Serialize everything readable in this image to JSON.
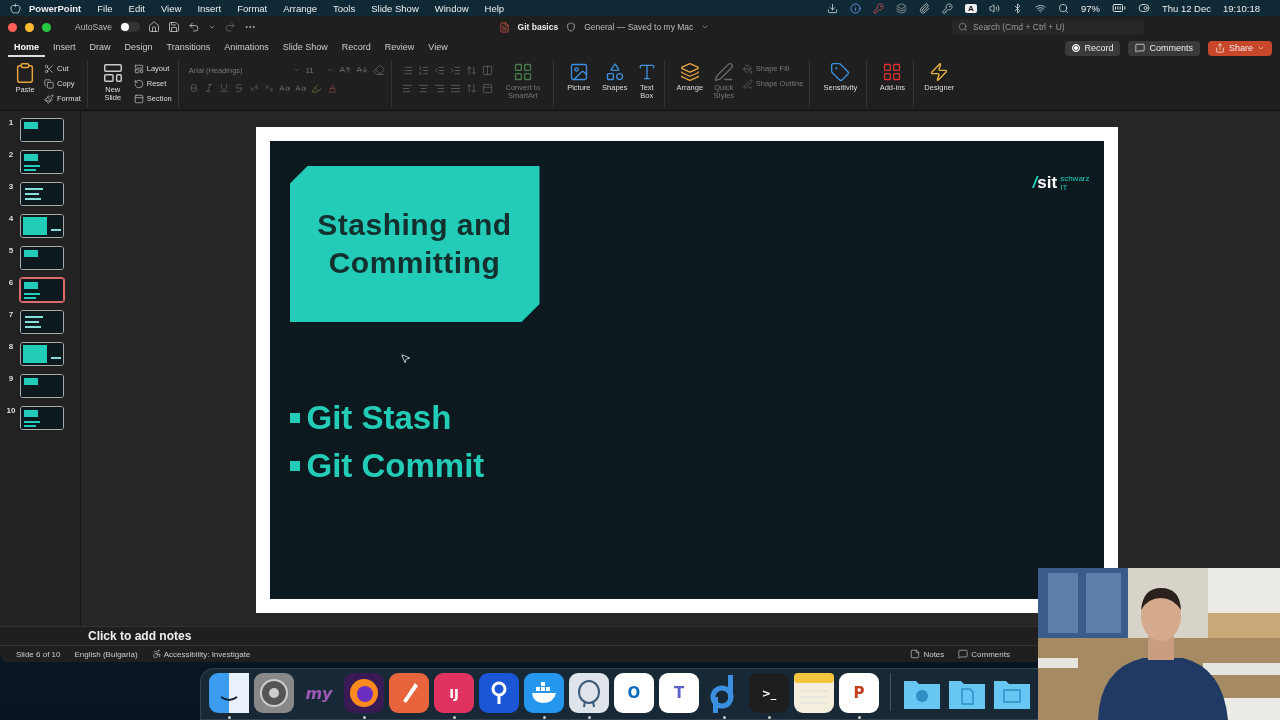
{
  "menu_bar": {
    "app": "PowerPoint",
    "items": [
      "File",
      "Edit",
      "View",
      "Insert",
      "Format",
      "Arrange",
      "Tools",
      "Slide Show",
      "Window",
      "Help"
    ],
    "input_source": "A",
    "battery": "97%",
    "date": "Thu 12 Dec",
    "time": "19:10:18"
  },
  "title_bar": {
    "autosave": {
      "label": "AutoSave",
      "on": false
    },
    "document": "Git basics",
    "status": "General — Saved to my Mac",
    "search": {
      "placeholder": "Search (Cmd + Ctrl + U)"
    }
  },
  "tabs": [
    {
      "label": "Home",
      "selected": true
    },
    {
      "label": "Insert",
      "selected": false
    },
    {
      "label": "Draw",
      "selected": false
    },
    {
      "label": "Design",
      "selected": false
    },
    {
      "label": "Transitions",
      "selected": false
    },
    {
      "label": "Animations",
      "selected": false
    },
    {
      "label": "Slide Show",
      "selected": false
    },
    {
      "label": "Record",
      "selected": false
    },
    {
      "label": "Review",
      "selected": false
    },
    {
      "label": "View",
      "selected": false
    }
  ],
  "actions": [
    {
      "label": "Record",
      "kind": "record"
    },
    {
      "label": "Comments",
      "kind": "comments"
    },
    {
      "label": "Share",
      "kind": "share"
    }
  ],
  "ribbon": {
    "paste": {
      "label": "Paste",
      "disabled": false
    },
    "clipboard": [
      {
        "label": "Cut",
        "disabled": false
      },
      {
        "label": "Copy",
        "disabled": false
      },
      {
        "label": "Format",
        "disabled": false
      }
    ],
    "new_slide": {
      "label": "New Slide",
      "disabled": false
    },
    "slide_tools": [
      {
        "label": "Layout",
        "disabled": false
      },
      {
        "label": "Reset",
        "disabled": false
      },
      {
        "label": "Section",
        "disabled": false
      }
    ],
    "font": {
      "name": "Arial (Headings)",
      "size": "11",
      "disabled": true
    },
    "paragraph": {
      "disabled": true
    },
    "smartart": {
      "label": "Convert to SmartArt",
      "disabled": true
    },
    "insert": [
      {
        "label": "Picture",
        "disabled": false
      },
      {
        "label": "Shapes",
        "disabled": false
      },
      {
        "label": "Text Box",
        "disabled": false
      }
    ],
    "arrange": {
      "label": "Arrange",
      "disabled": false
    },
    "quick_styles": {
      "label": "Quick Styles",
      "disabled": true
    },
    "shape_format": [
      {
        "label": "Shape Fill",
        "disabled": true
      },
      {
        "label": "Shape Outline",
        "disabled": true
      }
    ],
    "extras": [
      {
        "label": "Sensitivity",
        "disabled": false
      },
      {
        "label": "Add-ins",
        "disabled": false
      },
      {
        "label": "Designer",
        "disabled": false
      }
    ]
  },
  "thumbnails": [
    {
      "number": "1",
      "selected": false
    },
    {
      "number": "2",
      "selected": false
    },
    {
      "number": "3",
      "selected": false
    },
    {
      "number": "4",
      "selected": false
    },
    {
      "number": "5",
      "selected": false
    },
    {
      "number": "6",
      "selected": true
    },
    {
      "number": "7",
      "selected": false
    },
    {
      "number": "8",
      "selected": false
    },
    {
      "number": "9",
      "selected": false
    },
    {
      "number": "10",
      "selected": false
    }
  ],
  "slide": {
    "title": "Stashing and Committing",
    "bullets": [
      "Git Stash",
      "Git Commit"
    ],
    "logo": {
      "mark": "/",
      "name": "sit",
      "tagline": [
        "schwarz",
        "IT"
      ]
    }
  },
  "notes": {
    "prompt": "Click to add notes"
  },
  "status_bar": {
    "slide": "Slide 6 of 10",
    "language": "English (Bulgaria)",
    "accessibility": "Accessibility: Investigate",
    "notes": "Notes",
    "comments": "Comments"
  },
  "dock": [
    {
      "kind": "app",
      "running": true
    },
    {
      "kind": "app",
      "running": false
    },
    {
      "kind": "app",
      "running": false,
      "glyph": "my"
    },
    {
      "kind": "app",
      "running": true
    },
    {
      "kind": "app",
      "running": false
    },
    {
      "kind": "app",
      "running": true,
      "glyph": "IJ"
    },
    {
      "kind": "app",
      "running": false
    },
    {
      "kind": "app",
      "running": true
    },
    {
      "kind": "app",
      "running": true
    },
    {
      "kind": "app",
      "running": false,
      "glyph": "O"
    },
    {
      "kind": "app",
      "running": false,
      "glyph": "T"
    },
    {
      "kind": "app",
      "running": true
    },
    {
      "kind": "app",
      "running": true,
      "glyph": ">_"
    },
    {
      "kind": "app",
      "running": false
    },
    {
      "kind": "app",
      "running": true,
      "glyph": "P"
    },
    {
      "kind": "folder",
      "running": false
    },
    {
      "kind": "folder",
      "running": false
    },
    {
      "kind": "folder",
      "running": false
    }
  ]
}
